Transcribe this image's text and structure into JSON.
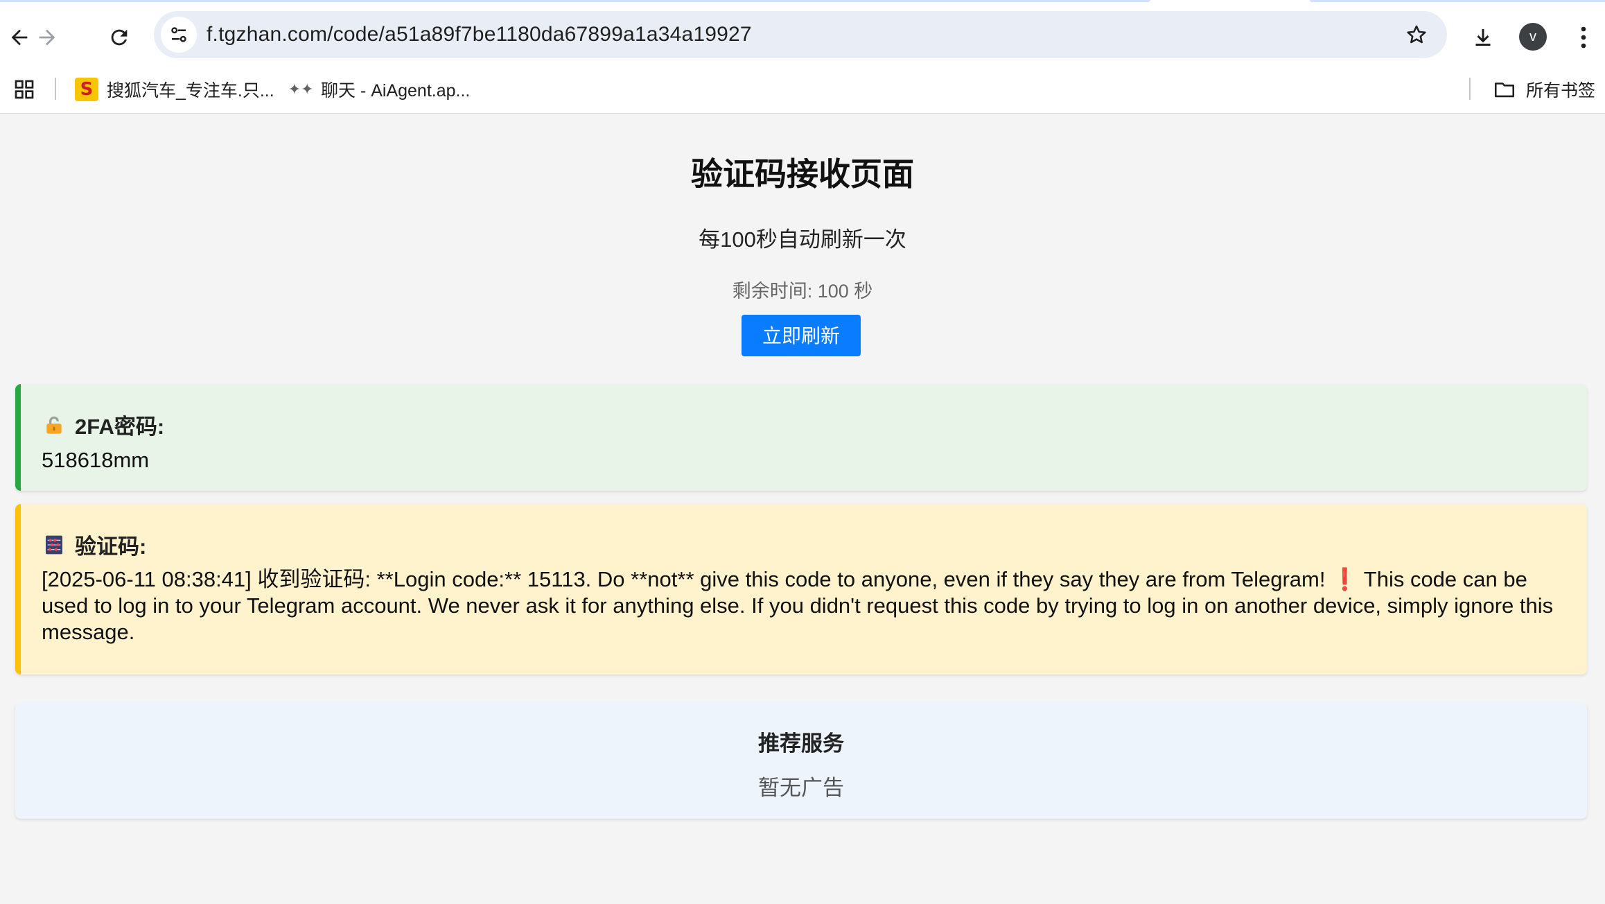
{
  "browser": {
    "url": "f.tgzhan.com/code/a51a89f7be1180da67899a1a34a19927",
    "avatar_letter": "v",
    "bookmarks": [
      {
        "label": "搜狐汽车_专注车.只...",
        "icon": "sohu-icon"
      },
      {
        "label": "聊天 - AiAgent.ap...",
        "icon": "aiagent-icon"
      }
    ],
    "all_bookmarks_label": "所有书签"
  },
  "page": {
    "title": "验证码接收页面",
    "refresh_note": "每100秒自动刷新一次",
    "countdown_text": "剩余时间: 100 秒",
    "refresh_button": "立即刷新"
  },
  "twofa": {
    "icon": "lock-icon",
    "label": "2FA密码:",
    "value": "518618mm"
  },
  "code": {
    "icon": "abacus-icon",
    "label": "验证码:",
    "message_part1": "[2025-06-11 08:38:41] 收到验证码: **Login code:** 15113. Do **not** give this code to anyone, even if they say they are from Telegram! ",
    "warning_glyph": "❗",
    "message_part2": "This code can be used to log in to your Telegram account. We never ask it for anything else. If you didn't request this code by trying to log in on another device, simply ignore this message."
  },
  "ads": {
    "title": "推荐服务",
    "empty_text": "暂无广告"
  },
  "colors": {
    "accent_blue": "#0a7cff",
    "success_green": "#28a745",
    "warning_yellow": "#ffc107"
  }
}
